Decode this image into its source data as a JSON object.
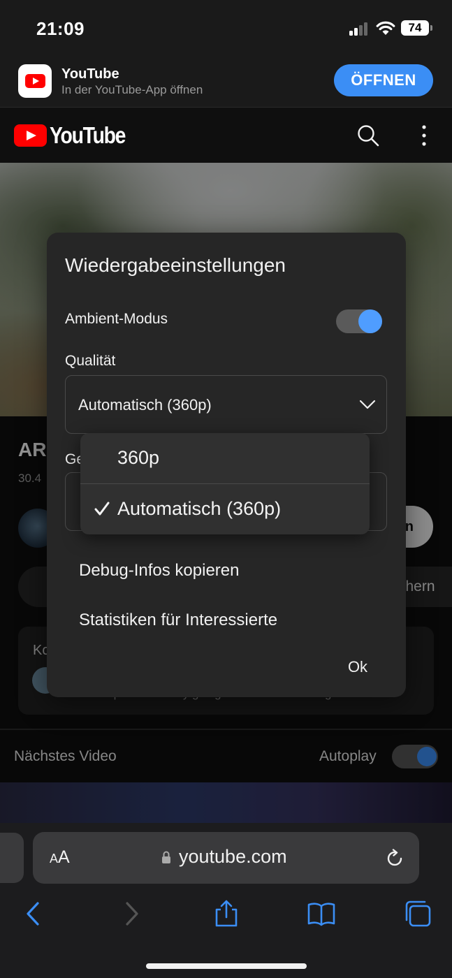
{
  "status_bar": {
    "time": "21:09",
    "battery": "74"
  },
  "app_banner": {
    "name": "YouTube",
    "subtitle": "In der YouTube-App öffnen",
    "open_label": "ÖFFNEN"
  },
  "header": {
    "logo_text": "YouTube",
    "search_icon": "search-icon",
    "more_icon": "more-vertical-icon"
  },
  "background_page": {
    "title_fragment": "AR",
    "views_fragment": "30.4",
    "subscribe_fragment": "n",
    "save_fragment": "chern",
    "comments_fragment": "Ko",
    "comment_text_fragment": "landscape is definitely going to be less frustrating.",
    "next_video_label": "Nächstes Video",
    "autoplay_label": "Autoplay",
    "autoplay_on": true
  },
  "settings_modal": {
    "title": "Wiedergabeeinstellungen",
    "ambient_label": "Ambient-Modus",
    "ambient_on": true,
    "quality_label": "Qualität",
    "quality_value": "Automatisch (360p)",
    "speed_label_fragment": "Ge",
    "debug_label": "Debug-Infos kopieren",
    "stats_label": "Statistiken für Interessierte",
    "ok_label": "Ok"
  },
  "quality_dropdown": {
    "options": [
      {
        "label": "360p",
        "selected": false
      },
      {
        "label": "Automatisch (360p)",
        "selected": true
      }
    ]
  },
  "safari": {
    "text_size_label": "AA",
    "url": "youtube.com",
    "icons": [
      "back-icon",
      "forward-icon",
      "share-icon",
      "bookmarks-icon",
      "tabs-icon"
    ]
  },
  "colors": {
    "accent": "#3b8ef5",
    "youtube_red": "#ff0000",
    "toggle_knob": "#4f9dff"
  }
}
